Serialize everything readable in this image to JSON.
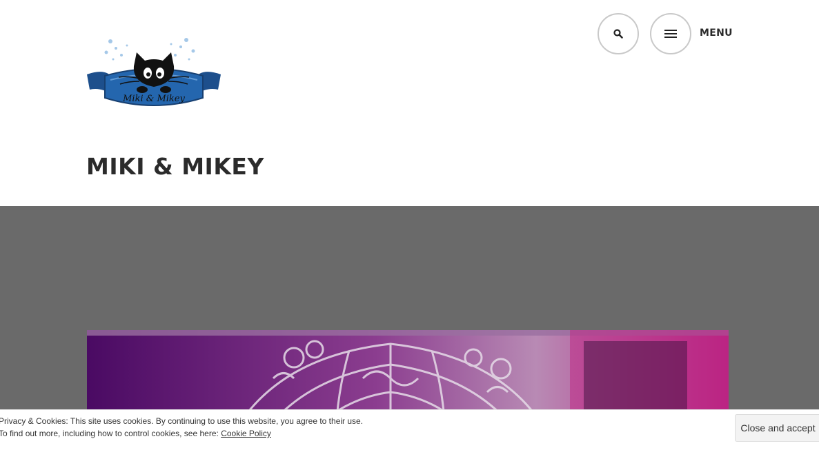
{
  "header": {
    "logo_text": "Miki & Mikey",
    "site_title": "MIKI & MIKEY",
    "search_icon": "search-icon",
    "menu_icon": "hamburger-icon",
    "menu_label": "MENU"
  },
  "cookie_banner": {
    "line1": "Privacy & Cookies: This site uses cookies. By continuing to use this website, you agree to their use.",
    "line2_prefix": "To find out more, including how to control cookies, see here: ",
    "policy_link": "Cookie Policy",
    "accept_label": "Close and accept"
  },
  "colors": {
    "hero_background": "#6a6a6a",
    "featured_tint": "#7a1a8a",
    "title_color": "#2b2b2b",
    "banner_blue": "#1f5fa8"
  }
}
